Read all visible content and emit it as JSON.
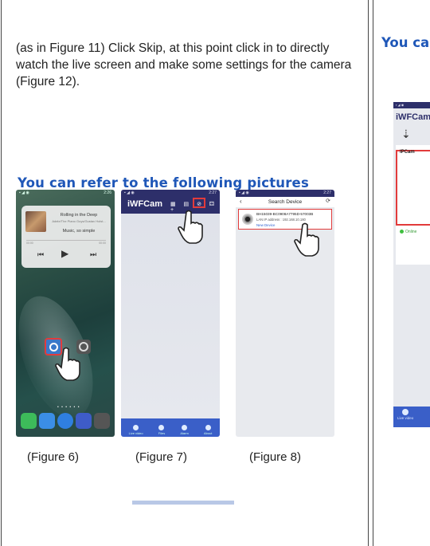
{
  "instruction": "(as in Figure 11) Click Skip, at this point click in to directly watch the live screen and make some settings for the camera (Figure 12).",
  "heading": "You can refer to the following pictures",
  "heading_right": "You ca",
  "phone1": {
    "status_time": "2:26",
    "song_title": "Rolling in the Deep",
    "song_artist": "Adele/The Piano Guys/Gustav Holst...",
    "lyric": "Music, so simple",
    "time_start": "00:00",
    "time_end": "00:00",
    "page_dots": "• • • • • •"
  },
  "phone2": {
    "status_time": "2:27",
    "app_title": "iWFCam",
    "header_icons": "▦ ▤ ⊘ ⚃ +",
    "tabs": [
      "Live video",
      "Files",
      "Alarm",
      "About"
    ]
  },
  "phone3": {
    "status_time": "2:27",
    "title": "Search Device",
    "device_id": "BH15039-BC0908A7795D-57003B",
    "lan_ip": "LAN IP address : 192.168.10.180",
    "new_device": "New Device"
  },
  "captions": [
    "(Figure 6)",
    "(Figure 7)",
    "(Figure 8)"
  ],
  "right_phone": {
    "app_title": "iWFCam",
    "card_label": "IPCam",
    "status": "Online",
    "tab": "Live video"
  },
  "colors": {
    "heading_blue": "#1f57b8",
    "header_navy": "#2d2f6a",
    "highlight_red": "#e23b3b",
    "tabbar_blue": "#3a5fc8"
  }
}
